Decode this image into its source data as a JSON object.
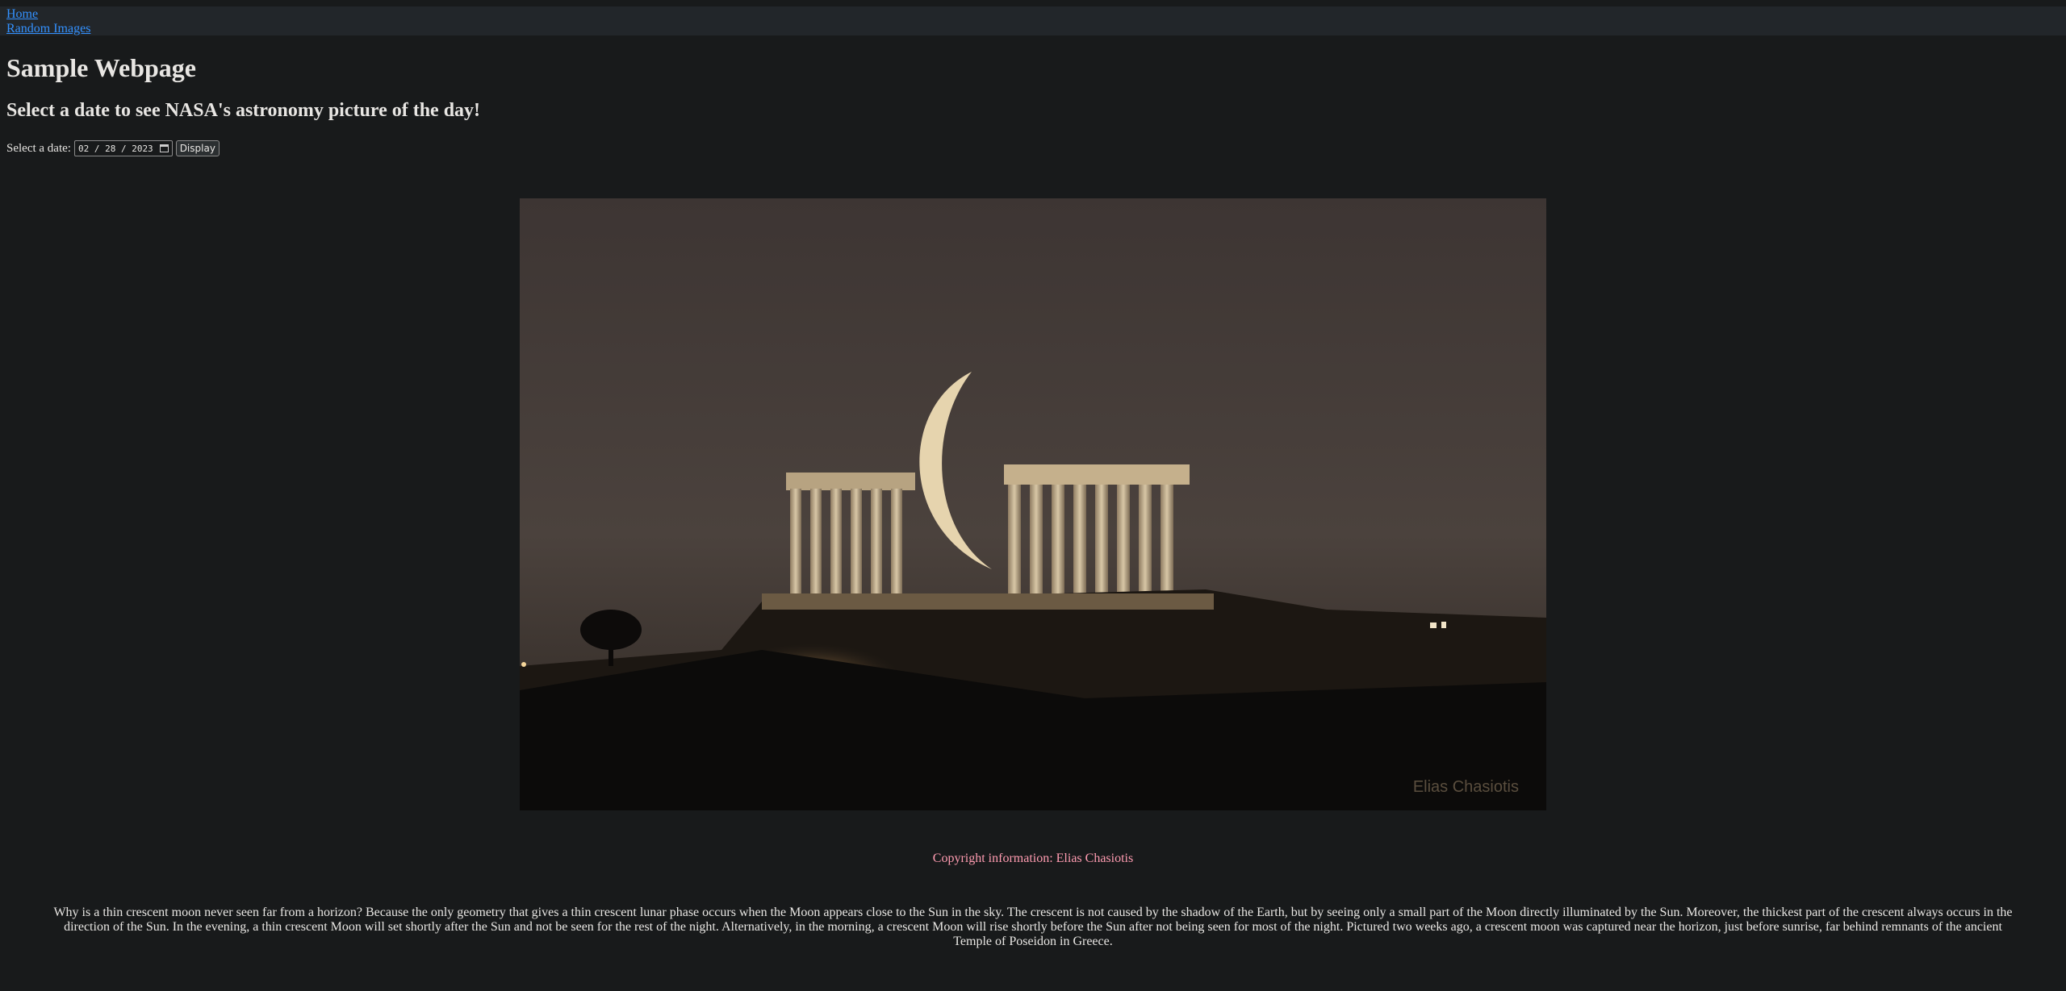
{
  "nav": {
    "home_label": "Home",
    "random_label": "Random Images"
  },
  "header": {
    "title": "Sample Webpage",
    "subtitle": "Select a date to see NASA's astronomy picture of the day!"
  },
  "date_picker": {
    "label": "Select a date:",
    "value": "02 / 28 / 2023",
    "icon": "calendar-icon",
    "button_label": "Display"
  },
  "apod": {
    "watermark": "Elias Chasiotis",
    "copyright": "Copyright information: Elias Chasiotis",
    "explanation": "Why is a thin crescent moon never seen far from a horizon? Because the only geometry that gives a thin crescent lunar phase occurs when the Moon appears close to the Sun in the sky. The crescent is not caused by the shadow of the Earth, but by seeing only a small part of the Moon directly illuminated by the Sun. Moreover, the thickest part of the crescent always occurs in the direction of the Sun. In the evening, a thin crescent Moon will set shortly after the Sun and not be seen for the rest of the night. Alternatively, in the morning, a crescent Moon will rise shortly before the Sun after not being seen for most of the night. Pictured two weeks ago, a crescent moon was captured near the horizon, just before sunrise, far behind remnants of the ancient Temple of Poseidon in Greece."
  },
  "colors": {
    "background": "#181a1b",
    "link": "#3391ff",
    "copyright": "#ff9cb1"
  }
}
